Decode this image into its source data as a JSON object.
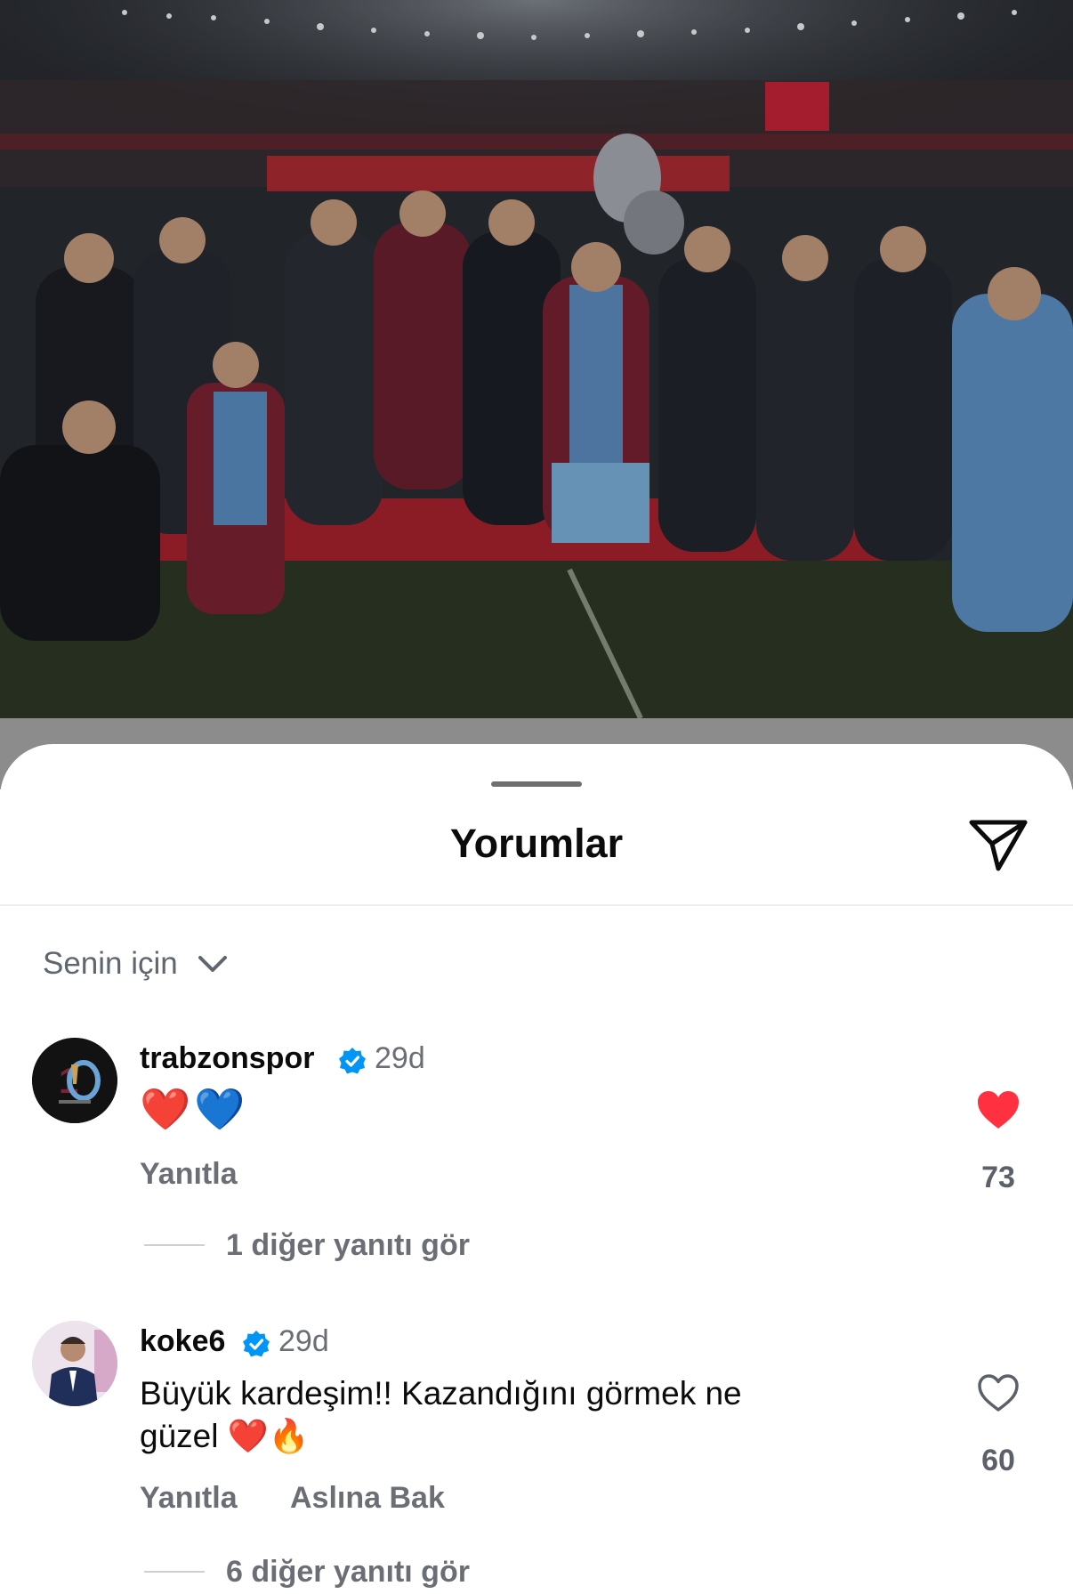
{
  "sheet": {
    "title": "Yorumlar",
    "sort_label": "Senin için"
  },
  "comments": [
    {
      "username": "trabzonspor",
      "verified": true,
      "time": "29d",
      "text": "❤️💙",
      "reply_label": "Yanıtla",
      "likes": "73",
      "liked": true,
      "more_replies": "1 diğer yanıtı gör"
    },
    {
      "username": "koke6",
      "verified": true,
      "time": "29d",
      "text_line1": "Büyük kardeşim!! Kazandığını görmek ne",
      "text_line2": "güzel ❤️🔥",
      "reply_label": "Yanıtla",
      "translate_label": "Aslına Bak",
      "likes": "60",
      "liked": false,
      "more_replies": "6 diğer yanıtı gör"
    }
  ],
  "colors": {
    "liked_heart": "#ff3040",
    "verified_badge": "#0095f6"
  }
}
